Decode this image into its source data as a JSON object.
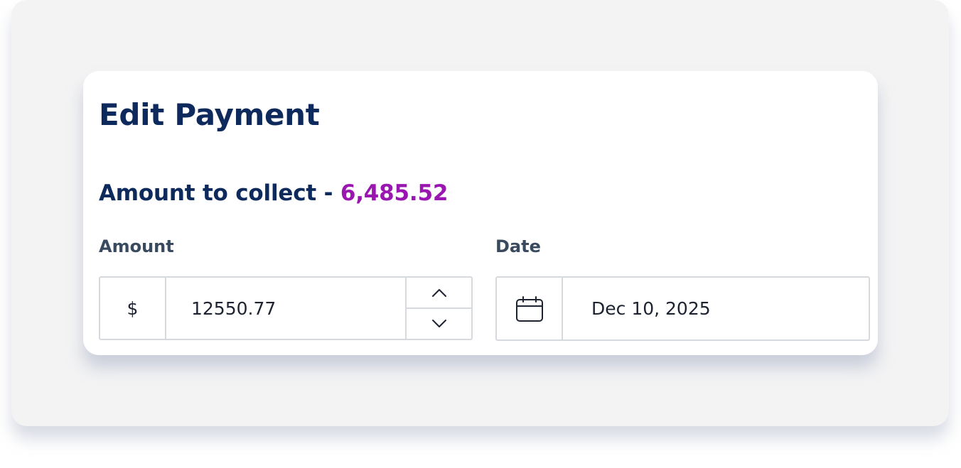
{
  "form": {
    "title": "Edit Payment",
    "amount_to_collect_label": "Amount to collect - ",
    "amount_to_collect_value": "6,485.52",
    "highlight_color": "#9a16b0"
  },
  "amount_field": {
    "label": "Amount",
    "prefix": "$",
    "value": "12550.77",
    "increment_icon": "chevron-up-icon",
    "decrement_icon": "chevron-down-icon"
  },
  "date_field": {
    "label": "Date",
    "icon": "calendar-icon",
    "value": "Dec 10, 2025"
  }
}
